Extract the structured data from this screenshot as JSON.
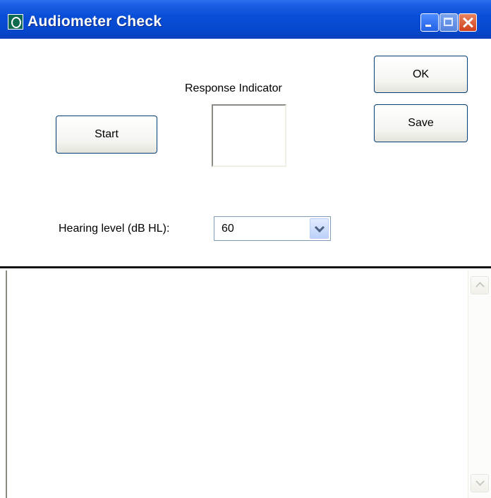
{
  "window": {
    "title": "Audiometer Check"
  },
  "buttons": {
    "start": "Start",
    "ok": "OK",
    "save": "Save"
  },
  "response_indicator": {
    "label": "Response Indicator"
  },
  "hearing_level": {
    "label": "Hearing level (dB HL):",
    "value": "60"
  },
  "log": {
    "content": ""
  },
  "icons": {
    "app": "app-icon",
    "minimize": "minimize-icon",
    "maximize": "maximize-icon",
    "close": "close-icon",
    "dropdown": "chevron-down-icon",
    "scroll_up": "scroll-up-icon",
    "scroll_down": "scroll-down-icon"
  },
  "colors": {
    "titlebar": "#0a4fd8",
    "close_button": "#cf3f1c",
    "button_border": "#003c74"
  }
}
